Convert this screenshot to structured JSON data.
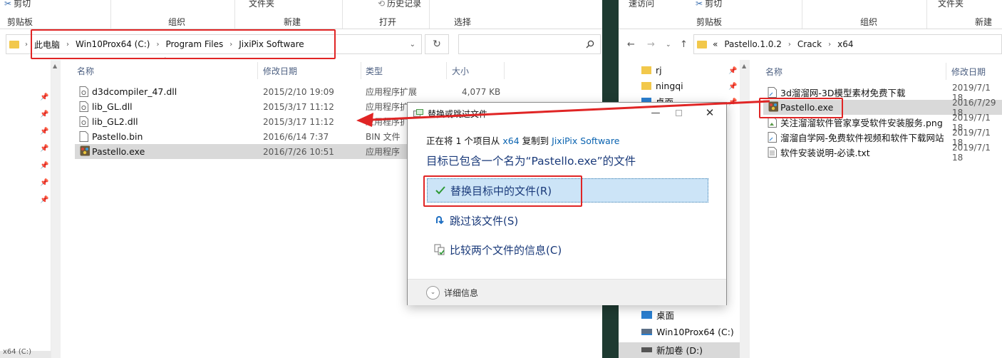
{
  "left": {
    "ribbon": {
      "cut": "剪切",
      "folder": "文件夹",
      "history": "历史记录",
      "clipboard": "剪贴板",
      "organize": "组织",
      "new": "新建",
      "open": "打开",
      "select": "选择"
    },
    "breadcrumbs": [
      "此电脑",
      "Win10Prox64 (C:)",
      "Program Files",
      "JixiPix Software"
    ],
    "columns": {
      "name": "名称",
      "date": "修改日期",
      "type": "类型",
      "size": "大小"
    },
    "files": [
      {
        "name": "d3dcompiler_47.dll",
        "date": "2015/2/10 19:09",
        "type": "应用程序扩展",
        "size": "4,077 KB"
      },
      {
        "name": "lib_GL.dll",
        "date": "2015/3/17 11:12",
        "type": "应用程序扩",
        "size": ""
      },
      {
        "name": "lib_GL2.dll",
        "date": "2015/3/17 11:12",
        "type": "应用程序扩",
        "size": ""
      },
      {
        "name": "Pastello.bin",
        "date": "2016/6/14 7:37",
        "type": "BIN 文件",
        "size": ""
      },
      {
        "name": "Pastello.exe",
        "date": "2016/7/26 10:51",
        "type": "应用程序",
        "size": ""
      }
    ],
    "status": "x64 (C:)"
  },
  "right": {
    "ribbon": {
      "quick_access": "速访问",
      "cut": "剪切",
      "folder": "文件夹",
      "clipboard": "剪贴板",
      "organize": "组织",
      "new": "新建"
    },
    "breadcrumbs": [
      "«",
      "Pastello.1.0.2",
      "Crack",
      "x64"
    ],
    "tree": [
      {
        "name": "rj"
      },
      {
        "name": "ningqi"
      },
      {
        "name": "桌面"
      }
    ],
    "tree_bottom": [
      {
        "name": "桌面"
      },
      {
        "name": "Win10Prox64 (C:)"
      },
      {
        "name": "新加卷 (D:)"
      }
    ],
    "columns": {
      "name": "名称",
      "date": "修改日期"
    },
    "files": [
      {
        "name": "3d溜溜网-3D模型素材免费下载",
        "date": "2019/7/1 18"
      },
      {
        "name": "Pastello.exe",
        "date": "2016/7/29 18"
      },
      {
        "name": "关注溜溜软件管家享受软件安装服务.png",
        "date": "2019/7/1 18"
      },
      {
        "name": "溜溜自学网-免费软件视频和软件下载网站",
        "date": "2019/7/1 18"
      },
      {
        "name": "软件安装说明-必读.txt",
        "date": "2019/7/1 18"
      }
    ]
  },
  "dialog": {
    "title": "替换或跳过文件",
    "line1_prefix": "正在将 1 个项目从 ",
    "line1_from": "x64",
    "line1_mid": " 复制到 ",
    "line1_to": "JixiPix Software",
    "heading": "目标已包含一个名为“Pastello.exe”的文件",
    "options": [
      {
        "label": "替换目标中的文件(R)"
      },
      {
        "label": "跳过该文件(S)"
      },
      {
        "label": "比较两个文件的信息(C)"
      }
    ],
    "details": "详细信息"
  },
  "colors": {
    "highlight_red": "#e02525",
    "link_blue": "#0a63b0",
    "option_text": "#1a3a7a",
    "selected_option_bg": "#cce4f7",
    "selected_row_bg": "#d9d9d9",
    "check_green": "#2e9a35"
  }
}
